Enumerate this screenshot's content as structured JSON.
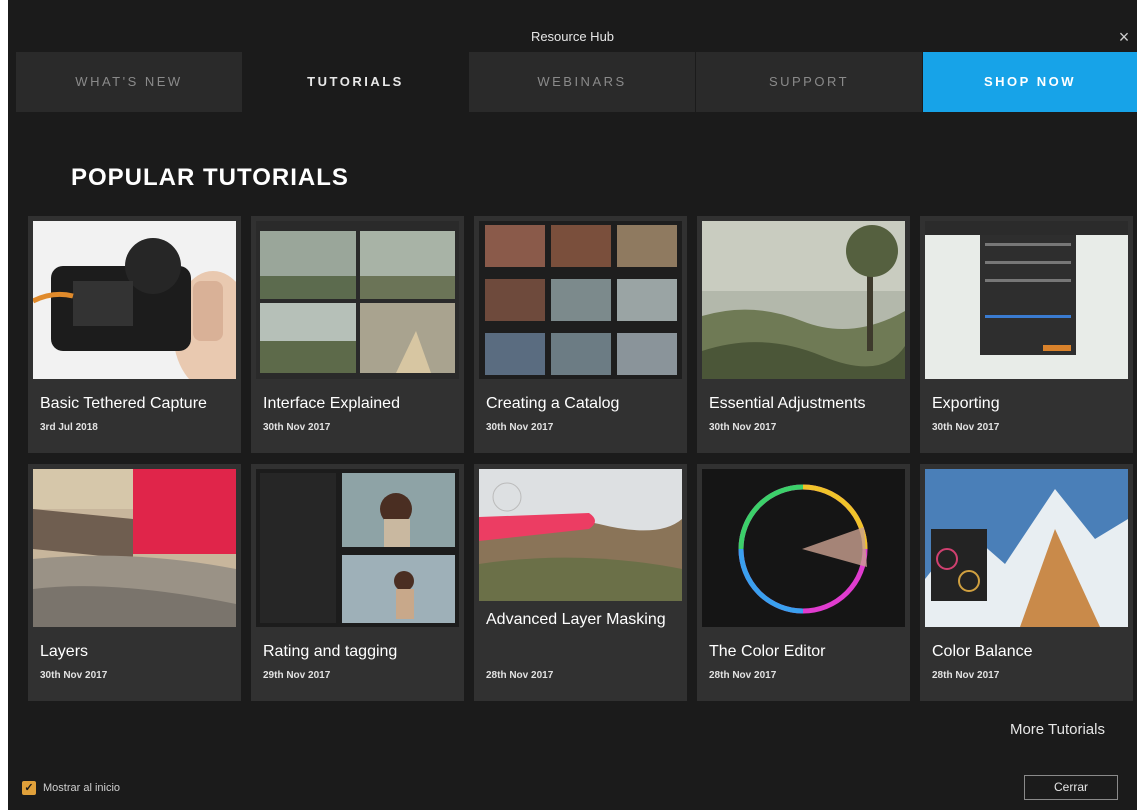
{
  "window": {
    "title": "Resource Hub",
    "close_glyph": "×"
  },
  "tabs": [
    {
      "label": "WHAT'S NEW"
    },
    {
      "label": "TUTORIALS"
    },
    {
      "label": "WEBINARS"
    },
    {
      "label": "SUPPORT"
    },
    {
      "label": "SHOP NOW"
    }
  ],
  "main": {
    "section_title": "POPULAR TUTORIALS",
    "tutorials": [
      {
        "title": "Basic Tethered Capture",
        "date": "3rd Jul 2018",
        "thumb": "camera-photo"
      },
      {
        "title": "Interface Explained",
        "date": "30th Nov 2017",
        "thumb": "landscape-grid"
      },
      {
        "title": "Creating a Catalog",
        "date": "30th Nov 2017",
        "thumb": "catalog-filmstrip"
      },
      {
        "title": "Essential Adjustments",
        "date": "30th Nov 2017",
        "thumb": "lake-landscape"
      },
      {
        "title": "Exporting",
        "date": "30th Nov 2017",
        "thumb": "export-dialog"
      },
      {
        "title": "Layers",
        "date": "30th Nov 2017",
        "thumb": "desert-layers"
      },
      {
        "title": "Rating and tagging",
        "date": "29th Nov 2017",
        "thumb": "portrait-browser"
      },
      {
        "title": "Advanced Layer Masking",
        "date": "28th Nov 2017",
        "thumb": "mask-hills"
      },
      {
        "title": "The Color Editor",
        "date": "28th Nov 2017",
        "thumb": "color-wheel"
      },
      {
        "title": "Color Balance",
        "date": "28th Nov 2017",
        "thumb": "mountain-color"
      }
    ],
    "more_link": "More Tutorials"
  },
  "footer": {
    "show_on_start_label": "Mostrar al inicio",
    "show_on_start_checked": true,
    "close_button": "Cerrar"
  },
  "colors": {
    "accent": "#17a3e8",
    "background": "#1b1b1b",
    "card": "#313131",
    "checkbox": "#e0a03a"
  }
}
